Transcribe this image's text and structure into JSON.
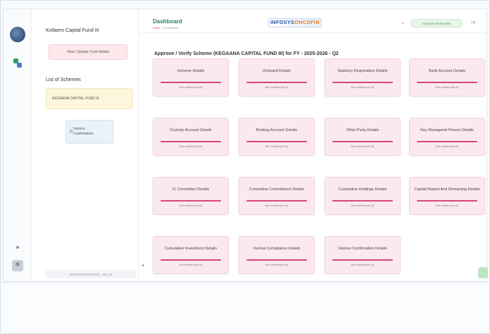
{
  "sidebar": {
    "fund_name": "Kotlaero Capital Fund III",
    "trust_button": "View / Update Trust Details",
    "schemes_heading": "List of Schemes",
    "scheme_item": "KEGAANA CAPITAL FUND III",
    "sub_item_line1": "Various",
    "sub_item_line2": "Confirmation",
    "footer_text": "INVESTOR APPROVER - ABC XII"
  },
  "header": {
    "title": "Dashboard",
    "breadcrumb_home": "Home",
    "breadcrumb_current": "Confirmation",
    "brand_left": "INFOSYS",
    "brand_right": "ONCOFIN",
    "pill": "SCHEME APPROVER"
  },
  "main": {
    "title": "Approve / Verify Scheme (KEGAANA CAPITAL FUND III) for FY - 2025-2026 - Q2",
    "cards": [
      {
        "title": "Scheme Details",
        "status": "Not verified yet (0)"
      },
      {
        "title": "Onboard Details",
        "status": "Not verified yet (0)"
      },
      {
        "title": "Statutory Registration Details",
        "status": "Not verified yet (0)"
      },
      {
        "title": "Bank Account Details",
        "status": "Not verified yet (0)"
      },
      {
        "title": "Custody Account Details",
        "status": "Not verified yet (0)"
      },
      {
        "title": "Broking Account Details",
        "status": "Not verified yet (0)"
      },
      {
        "title": "Other Party Details",
        "status": "Not verified yet (0)"
      },
      {
        "title": "Key Managerial Person Details",
        "status": "Not verified yet (0)"
      },
      {
        "title": "IC Committee Details",
        "status": "Not verified yet (0)"
      },
      {
        "title": "Cumulative Commitment Details",
        "status": "Not verified yet (0)"
      },
      {
        "title": "Cumulative Holdings Details",
        "status": "Not verified yet (0)"
      },
      {
        "title": "Capital Raised And Remaining Details",
        "status": "Not verified yet (0)"
      },
      {
        "title": "Cumulative Investment Details",
        "status": "Not verified yet (0)"
      },
      {
        "title": "Various Compliance Details",
        "status": "Not verified yet (0)"
      },
      {
        "title": "Various Confirmation Details",
        "status": "Not verified yet (0)"
      }
    ]
  },
  "icons": [
    "app-logo-icon",
    "switch-icon",
    "user-icon",
    "chevron-down-icon",
    "logout-icon"
  ]
}
